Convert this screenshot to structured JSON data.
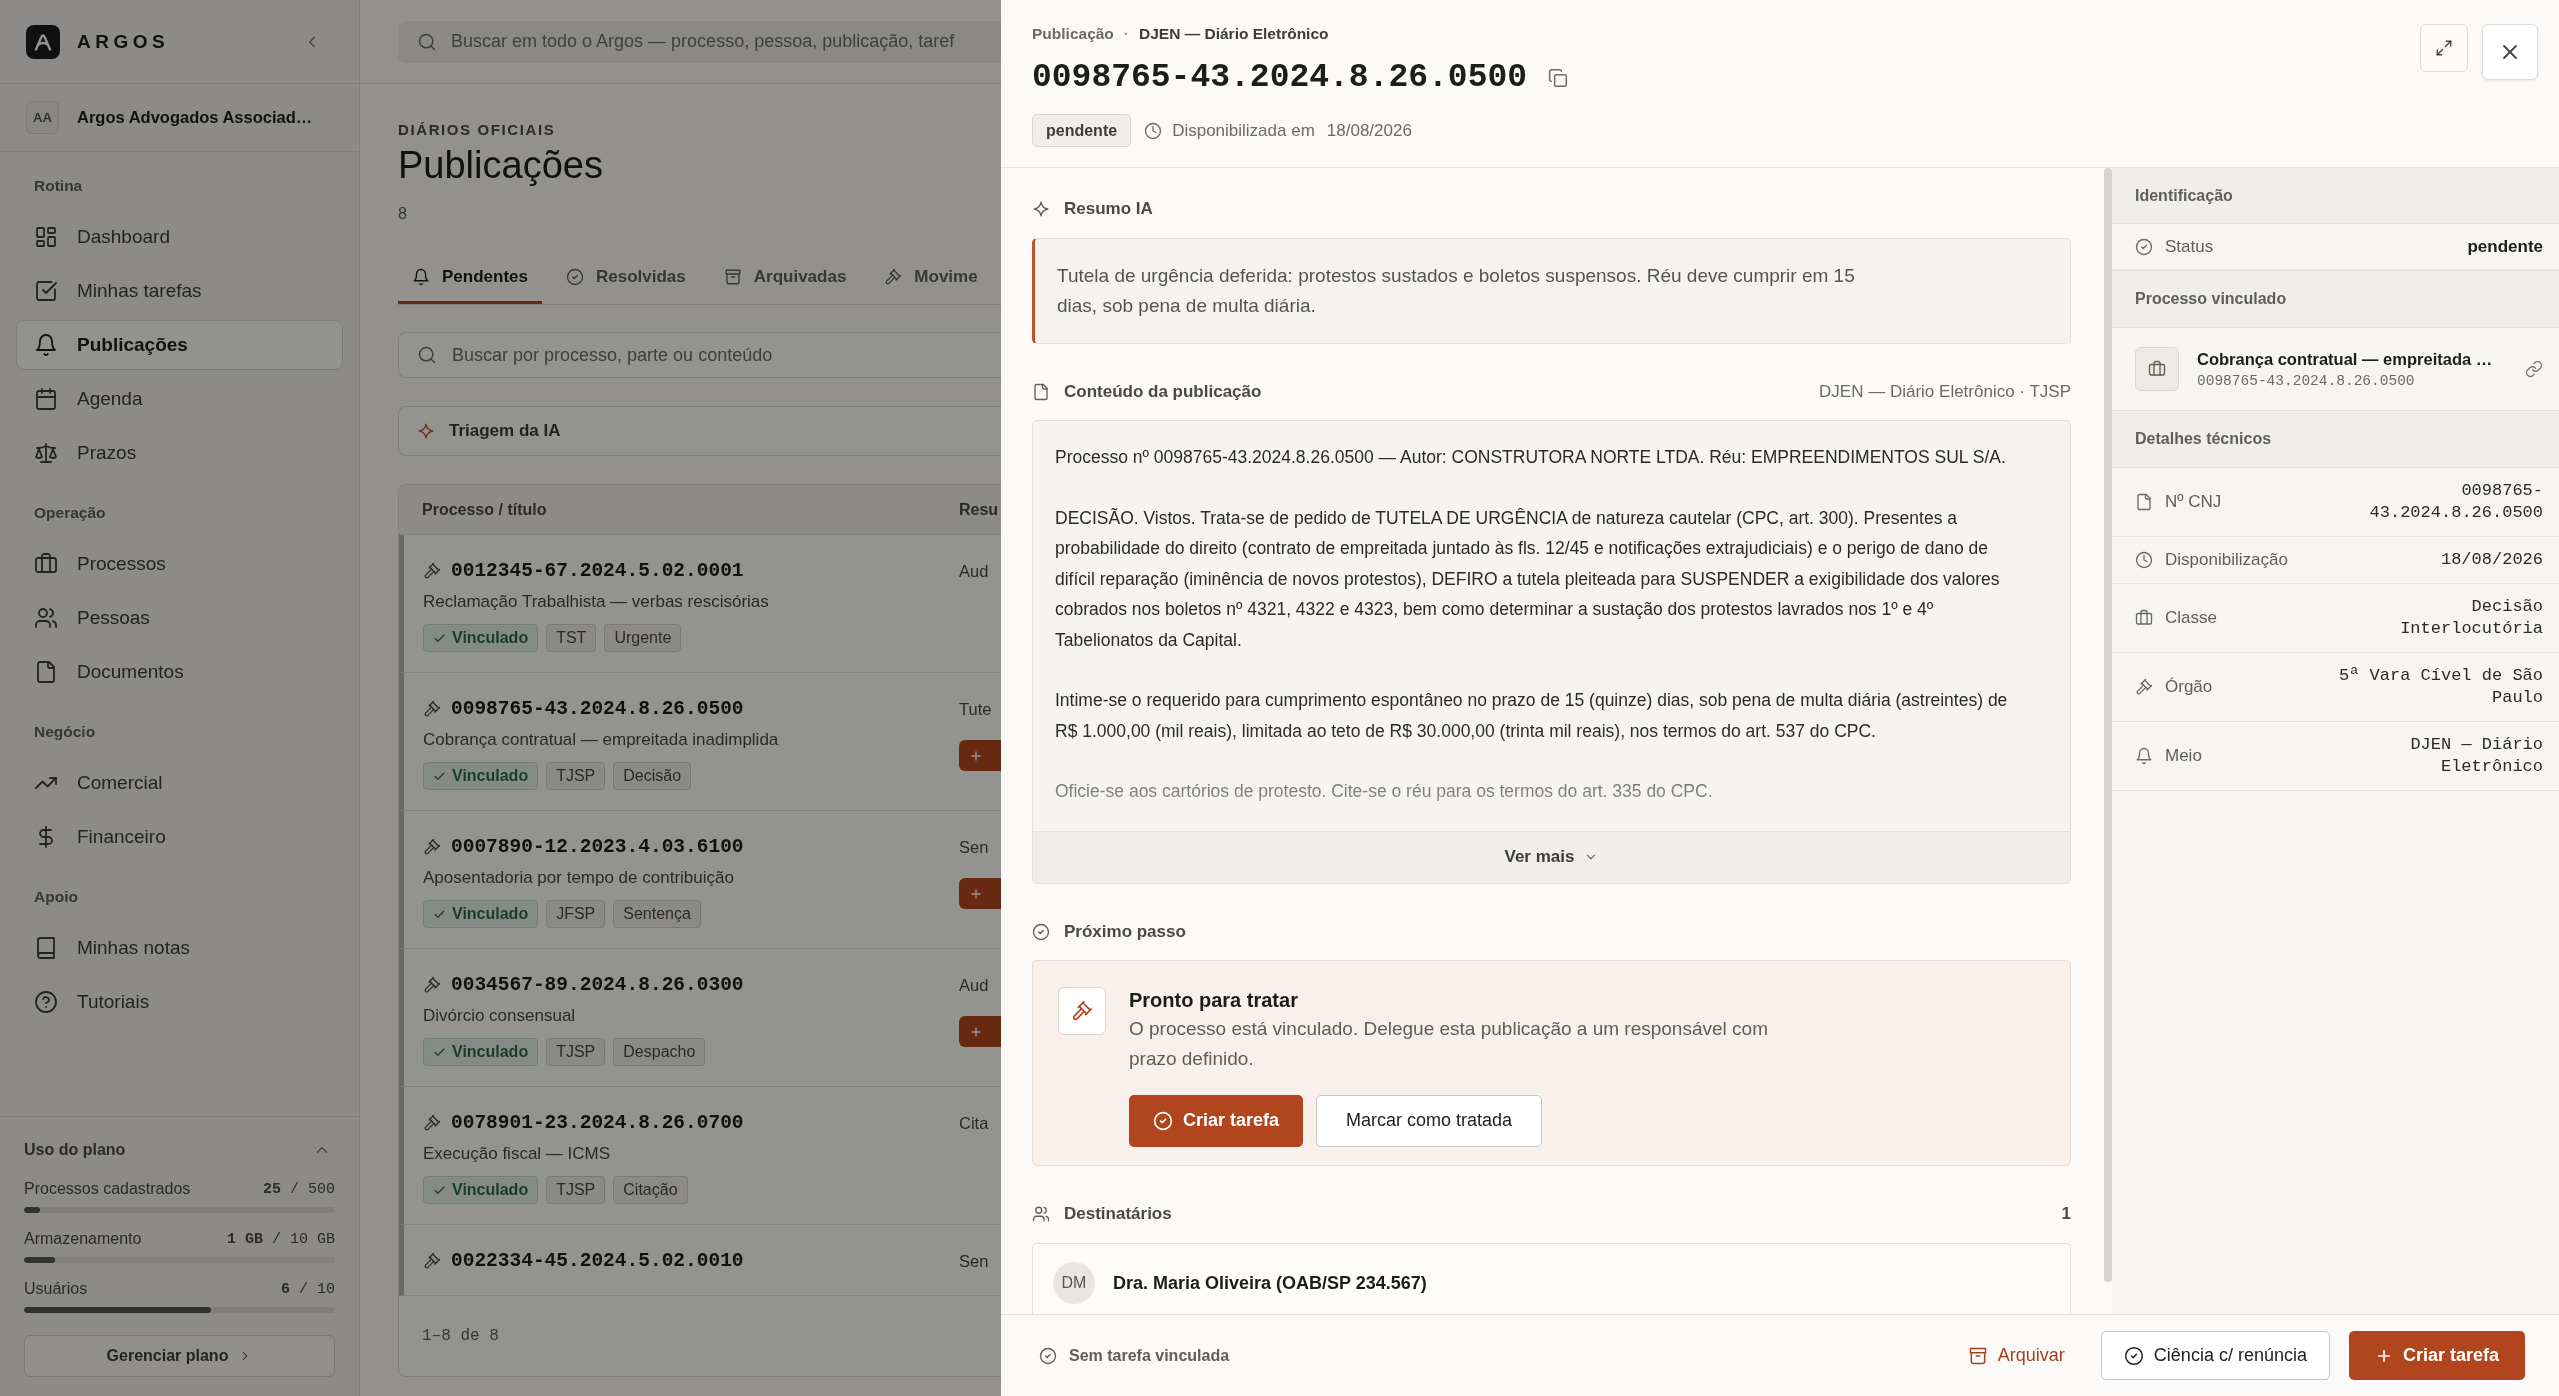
{
  "sidebar": {
    "brand": "ARGOS",
    "organization": {
      "initials": "AA",
      "name": "Argos Advogados Associad…"
    },
    "sections": [
      {
        "title": "Rotina",
        "items": [
          {
            "label": "Dashboard",
            "selected": false
          },
          {
            "label": "Minhas tarefas",
            "selected": false
          },
          {
            "label": "Publicações",
            "selected": true
          },
          {
            "label": "Agenda",
            "selected": false
          },
          {
            "label": "Prazos",
            "selected": false
          }
        ]
      },
      {
        "title": "Operação",
        "items": [
          {
            "label": "Processos",
            "selected": false
          },
          {
            "label": "Pessoas",
            "selected": false
          },
          {
            "label": "Documentos",
            "selected": false
          }
        ]
      },
      {
        "title": "Negócio",
        "items": [
          {
            "label": "Comercial",
            "selected": false
          },
          {
            "label": "Financeiro",
            "selected": false
          }
        ]
      },
      {
        "title": "Apoio",
        "items": [
          {
            "label": "Minhas notas",
            "selected": false
          },
          {
            "label": "Tutoriais",
            "selected": false
          }
        ]
      }
    ],
    "plan_usage": {
      "title": "Uso do plano",
      "expanded": true,
      "meters": [
        {
          "label": "Processos cadastrados",
          "reading": "**25** / 500",
          "level": 0.05
        },
        {
          "label": "Armazenamento",
          "reading": "**1 GB** / 10 GB",
          "level": 0.1
        },
        {
          "label": "Usuários",
          "reading": "**6** / 10",
          "level": 0.6
        }
      ],
      "button": "Gerenciar plano"
    }
  },
  "topbar": {
    "search_placeholder": "Buscar em todo o Argos — processo, pessoa, publicação, taref"
  },
  "page": {
    "eyebrow": "DIÁRIOS OFICIAIS",
    "title": "Publicações",
    "count": "8"
  },
  "tabs": [
    {
      "label": "Pendentes",
      "selected": true
    },
    {
      "label": "Resolvidas",
      "selected": false
    },
    {
      "label": "Arquivadas",
      "selected": false
    },
    {
      "label": "Movime",
      "selected": false
    }
  ],
  "filter": {
    "placeholder": "Buscar por processo, parte ou conteúdo"
  },
  "ai_triage": {
    "label": "Triagem da IA"
  },
  "table": {
    "columns": [
      "Processo / título",
      "Resu"
    ],
    "rows": [
      {
        "number": "0012345-67.2024.5.02.0001",
        "title": "Reclamação Trabalhista — verbas rescisórias",
        "tags": [
          {
            "label": "Vinculado",
            "kind": "linked"
          },
          {
            "label": "TST",
            "kind": "plain"
          },
          {
            "label": "Urgente",
            "kind": "plain"
          }
        ],
        "column_2": "Aud",
        "action_button": false
      },
      {
        "number": "0098765-43.2024.8.26.0500",
        "title": "Cobrança contratual — empreitada inadimplida",
        "tags": [
          {
            "label": "Vinculado",
            "kind": "linked"
          },
          {
            "label": "TJSP",
            "kind": "plain"
          },
          {
            "label": "Decisão",
            "kind": "plain"
          }
        ],
        "column_2": "Tute",
        "action_button": true
      },
      {
        "number": "0007890-12.2023.4.03.6100",
        "title": "Aposentadoria por tempo de contribuição",
        "tags": [
          {
            "label": "Vinculado",
            "kind": "linked"
          },
          {
            "label": "JFSP",
            "kind": "plain"
          },
          {
            "label": "Sentença",
            "kind": "plain"
          }
        ],
        "column_2": "Sen",
        "action_button": true
      },
      {
        "number": "0034567-89.2024.8.26.0300",
        "title": "Divórcio consensual",
        "tags": [
          {
            "label": "Vinculado",
            "kind": "linked"
          },
          {
            "label": "TJSP",
            "kind": "plain"
          },
          {
            "label": "Despacho",
            "kind": "plain"
          }
        ],
        "column_2": "Aud",
        "action_button": true
      },
      {
        "number": "0078901-23.2024.8.26.0700",
        "title": "Execução fiscal — ICMS",
        "tags": [
          {
            "label": "Vinculado",
            "kind": "linked"
          },
          {
            "label": "TJSP",
            "kind": "plain"
          },
          {
            "label": "Citação",
            "kind": "plain"
          }
        ],
        "column_2": "Cita",
        "action_button": false
      },
      {
        "number": "0022334-45.2024.5.02.0010",
        "column_2": "Sen",
        "action_button": false
      }
    ],
    "footer": "1–8 de 8"
  },
  "drawer": {
    "breadcrumb": {
      "section": "Publicação",
      "separator": "·",
      "source": "DJEN — Diário Eletrônico"
    },
    "title": "0098765-43.2024.8.26.0500",
    "status": "pendente",
    "availability": {
      "label": "Disponibilizada em",
      "date": "18/08/2026"
    },
    "ai_summary": {
      "title": "Resumo IA",
      "text": "Tutela de urgência deferida: protestos sustados e boletos suspensos. Réu deve cumprir em 15 dias, sob pena de multa diária."
    },
    "content": {
      "title": "Conteúdo da publicação",
      "source": "DJEN — Diário Eletrônico · TJSP",
      "paragraphs": [
        "Processo nº 0098765-43.2024.8.26.0500 — Autor: CONSTRUTORA NORTE LTDA. Réu: EMPREENDIMENTOS SUL S/A.",
        "DECISÃO. Vistos. Trata-se de pedido de TUTELA DE URGÊNCIA de natureza cautelar (CPC, art. 300). Presentes a probabilidade do direito (contrato de empreitada juntado às fls. 12/45 e notificações extrajudiciais) e o perigo de dano de difícil reparação (iminência de novos protestos), DEFIRO a tutela pleiteada para SUSPENDER a exigibilidade dos valores cobrados nos boletos nº 4321, 4322 e 4323, bem como determinar a sustação dos protestos lavrados nos 1º e 4º Tabelionatos da Capital.",
        "Intime-se o requerido para cumprimento espontâneo no prazo de 15 (quinze) dias, sob pena de multa diária (astreintes) de R$ 1.000,00 (mil reais), limitada ao teto de R$ 30.000,00 (trinta mil reais), nos termos do art. 537 do CPC.",
        "Oficie-se aos cartórios de protesto. Cite-se o réu para os termos do art. 335 do CPC."
      ],
      "expanded": false,
      "toggle": "Ver mais"
    },
    "next_step": {
      "title": "Próximo passo",
      "heading": "Pronto para tratar",
      "description": "O processo está vinculado. Delegue esta publicação a um responsável com prazo definido.",
      "primary_button": "Criar tarefa",
      "secondary_button": "Marcar como tratada"
    },
    "recipients": {
      "title": "Destinatários",
      "count": "1",
      "items": [
        {
          "initials": "DM",
          "name": "Dra. Maria Oliveira (OAB/SP 234.567)"
        }
      ]
    },
    "side_panel": {
      "identification": {
        "title": "Identificação",
        "rows": [
          {
            "label": "Status",
            "value": "pendente"
          }
        ]
      },
      "linked_process": {
        "title": "Processo vinculado",
        "name": "Cobrança contratual — empreitada …",
        "number": "0098765-43.2024.8.26.0500"
      },
      "technical": {
        "title": "Detalhes técnicos",
        "rows": [
          {
            "label": "Nº CNJ",
            "value": "0098765-43.2024.8.26.0500"
          },
          {
            "label": "Disponibilização",
            "value": "18/08/2026"
          },
          {
            "label": "Classe",
            "value": "Decisão Interlocutória"
          },
          {
            "label": "Órgão",
            "value": "5ª Vara Cível de São Paulo"
          },
          {
            "label": "Meio",
            "value": "DJEN — Diário Eletrônico"
          }
        ]
      }
    },
    "footer": {
      "task_status": "Sem tarefa vinculada",
      "archive_button": "Arquivar",
      "acknowledge_button": "Ciência c/ renúncia",
      "create_button": "Criar tarefa"
    }
  }
}
